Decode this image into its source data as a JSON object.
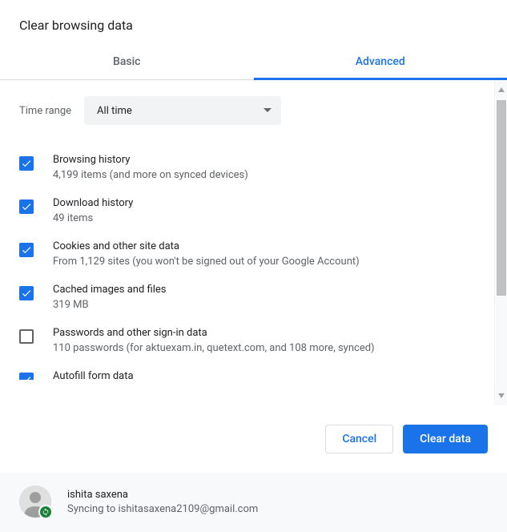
{
  "title": "Clear browsing data",
  "tabs": {
    "basic": "Basic",
    "advanced": "Advanced"
  },
  "time_range": {
    "label": "Time range",
    "value": "All time"
  },
  "options": [
    {
      "checked": true,
      "title": "Browsing history",
      "desc": "4,199 items (and more on synced devices)"
    },
    {
      "checked": true,
      "title": "Download history",
      "desc": "49 items"
    },
    {
      "checked": true,
      "title": "Cookies and other site data",
      "desc": "From 1,129 sites (you won't be signed out of your Google Account)"
    },
    {
      "checked": true,
      "title": "Cached images and files",
      "desc": "319 MB"
    },
    {
      "checked": false,
      "title": "Passwords and other sign-in data",
      "desc": "110 passwords (for aktuexam.in, quetext.com, and 108 more, synced)"
    },
    {
      "checked": true,
      "title": "Autofill form data",
      "desc": ""
    }
  ],
  "buttons": {
    "cancel": "Cancel",
    "clear": "Clear data"
  },
  "account": {
    "name": "ishita saxena",
    "status": "Syncing to ishitasaxena2109@gmail.com"
  }
}
